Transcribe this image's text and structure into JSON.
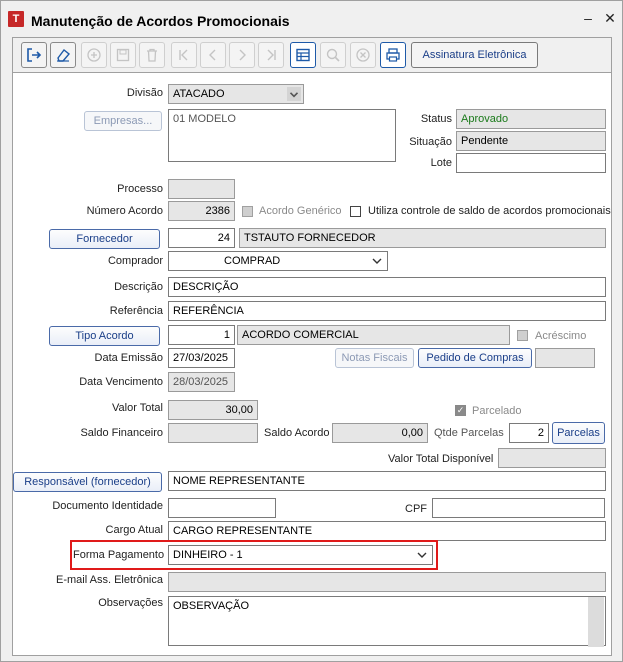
{
  "window": {
    "app_icon_letter": "T",
    "title": "Manutenção de Acordos Promocionais",
    "minimize_glyph": "–",
    "close_glyph": "✕"
  },
  "toolbar": {
    "icons": [
      "exit-icon",
      "eraser-icon",
      "add-icon",
      "save-icon",
      "delete-icon",
      "first-record-icon",
      "previous-record-icon",
      "next-record-icon",
      "last-record-icon",
      "grid-view-icon",
      "search-icon",
      "cancel-icon",
      "print-icon"
    ],
    "signature_label": "Assinatura Eletrônica"
  },
  "form": {
    "divisao": {
      "label": "Divisão",
      "value": "ATACADO"
    },
    "empresas": {
      "button": "Empresas...",
      "value": "01 MODELO"
    },
    "status": {
      "label": "Status",
      "value": "Aprovado"
    },
    "situacao": {
      "label": "Situação",
      "value": "Pendente"
    },
    "lote": {
      "label": "Lote",
      "value": ""
    },
    "processo": {
      "label": "Processo",
      "value": ""
    },
    "numero_acordo": {
      "label": "Número Acordo",
      "value": "2386"
    },
    "acordo_generico": {
      "label": "Acordo Genérico"
    },
    "controle_saldo": {
      "label": "Utiliza controle de saldo de acordos promocionais"
    },
    "fornecedor": {
      "button": "Fornecedor",
      "code": "24",
      "name": "TSTAUTO FORNECEDOR"
    },
    "comprador": {
      "label": "Comprador",
      "value": "COMPRAD"
    },
    "descricao": {
      "label": "Descrição",
      "value": "DESCRIÇÃO"
    },
    "referencia": {
      "label": "Referência",
      "value": "REFERÊNCIA"
    },
    "tipo_acordo": {
      "button": "Tipo Acordo",
      "code": "1",
      "name": "ACORDO COMERCIAL"
    },
    "acrescimo": {
      "label": "Acréscimo"
    },
    "data_emissao": {
      "label": "Data Emissão",
      "value": "27/03/2025"
    },
    "notas_fiscais": {
      "button": "Notas Fiscais"
    },
    "pedido_compras": {
      "button": "Pedido de Compras",
      "value": ""
    },
    "data_vencimento": {
      "label": "Data Vencimento",
      "value": "28/03/2025"
    },
    "valor_total": {
      "label": "Valor Total",
      "value": "30,00"
    },
    "parcelado": {
      "label": "Parcelado"
    },
    "saldo_financeiro": {
      "label": "Saldo Financeiro",
      "value": ""
    },
    "saldo_acordo": {
      "label": "Saldo Acordo",
      "value": "0,00"
    },
    "qtde_parcelas": {
      "label": "Qtde Parcelas",
      "value": "2"
    },
    "parcelas": {
      "button": "Parcelas"
    },
    "valor_total_disponivel": {
      "label": "Valor Total Disponível",
      "value": ""
    },
    "responsavel": {
      "button": "Responsável (fornecedor)",
      "value": "NOME REPRESENTANTE"
    },
    "documento_identidade": {
      "label": "Documento Identidade",
      "value": ""
    },
    "cpf": {
      "label": "CPF",
      "value": ""
    },
    "cargo_atual": {
      "label": "Cargo Atual",
      "value": "CARGO REPRESENTANTE"
    },
    "forma_pagamento": {
      "label": "Forma Pagamento",
      "value": "DINHEIRO - 1"
    },
    "email_ass": {
      "label": "E-mail Ass. Eletrônica",
      "value": ""
    },
    "observacoes": {
      "label": "Observações",
      "value": "OBSERVAÇÃO"
    }
  },
  "colors": {
    "highlight": "#e01a1a",
    "status_green": "#1a7a1a",
    "button_text": "#1a3e88"
  }
}
